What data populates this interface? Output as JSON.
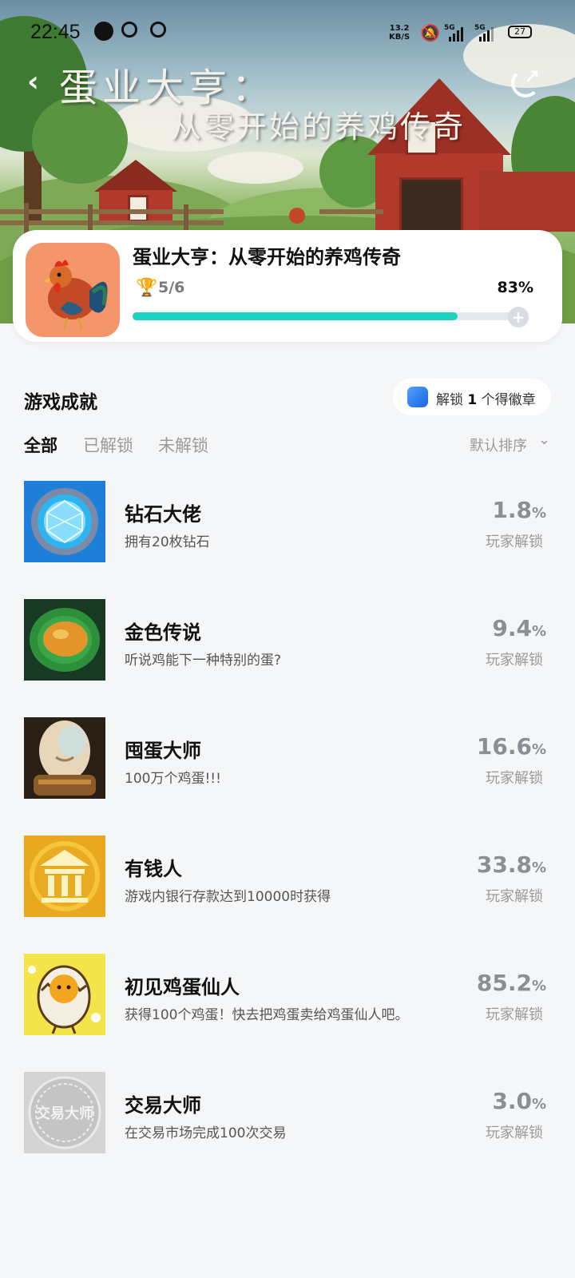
{
  "status": {
    "time": "22:45",
    "net_speed": "13.2",
    "net_unit": "KB/S",
    "sig1": "5G",
    "sig2": "5G",
    "battery": "27"
  },
  "hero": {
    "title_line1": "蛋业大亨：",
    "title_line2": "从零开始的养鸡传奇"
  },
  "game": {
    "name": "蛋业大亨：从零开始的养鸡传奇",
    "unlocked": "5/6",
    "percent_label": "83%",
    "progress": 0.83
  },
  "section": {
    "title": "游戏成就",
    "badge_prefix": "解锁",
    "badge_count": "1",
    "badge_suffix": "个得徽章"
  },
  "tabs": [
    "全部",
    "已解锁",
    "未解锁"
  ],
  "sort_label": "默认排序",
  "achievements": [
    {
      "name": "钻石大佬",
      "desc": "拥有20枚钻石",
      "pct": "1.8",
      "unit": "%",
      "sub": "玩家解锁"
    },
    {
      "name": "金色传说",
      "desc": "听说鸡能下一种特别的蛋?",
      "pct": "9.4",
      "unit": "%",
      "sub": "玩家解锁"
    },
    {
      "name": "囤蛋大师",
      "desc": "100万个鸡蛋!!!",
      "pct": "16.6",
      "unit": "%",
      "sub": "玩家解锁"
    },
    {
      "name": "有钱人",
      "desc": "游戏内银行存款达到10000时获得",
      "pct": "33.8",
      "unit": "%",
      "sub": "玩家解锁"
    },
    {
      "name": "初见鸡蛋仙人",
      "desc": "获得100个鸡蛋！快去把鸡蛋卖给鸡蛋仙人吧。",
      "pct": "85.2",
      "unit": "%",
      "sub": "玩家解锁"
    },
    {
      "name": "交易大师",
      "desc": "在交易市场完成100次交易",
      "pct": "3.0",
      "unit": "%",
      "sub": "玩家解锁"
    }
  ],
  "stamp_text": "交易大师"
}
